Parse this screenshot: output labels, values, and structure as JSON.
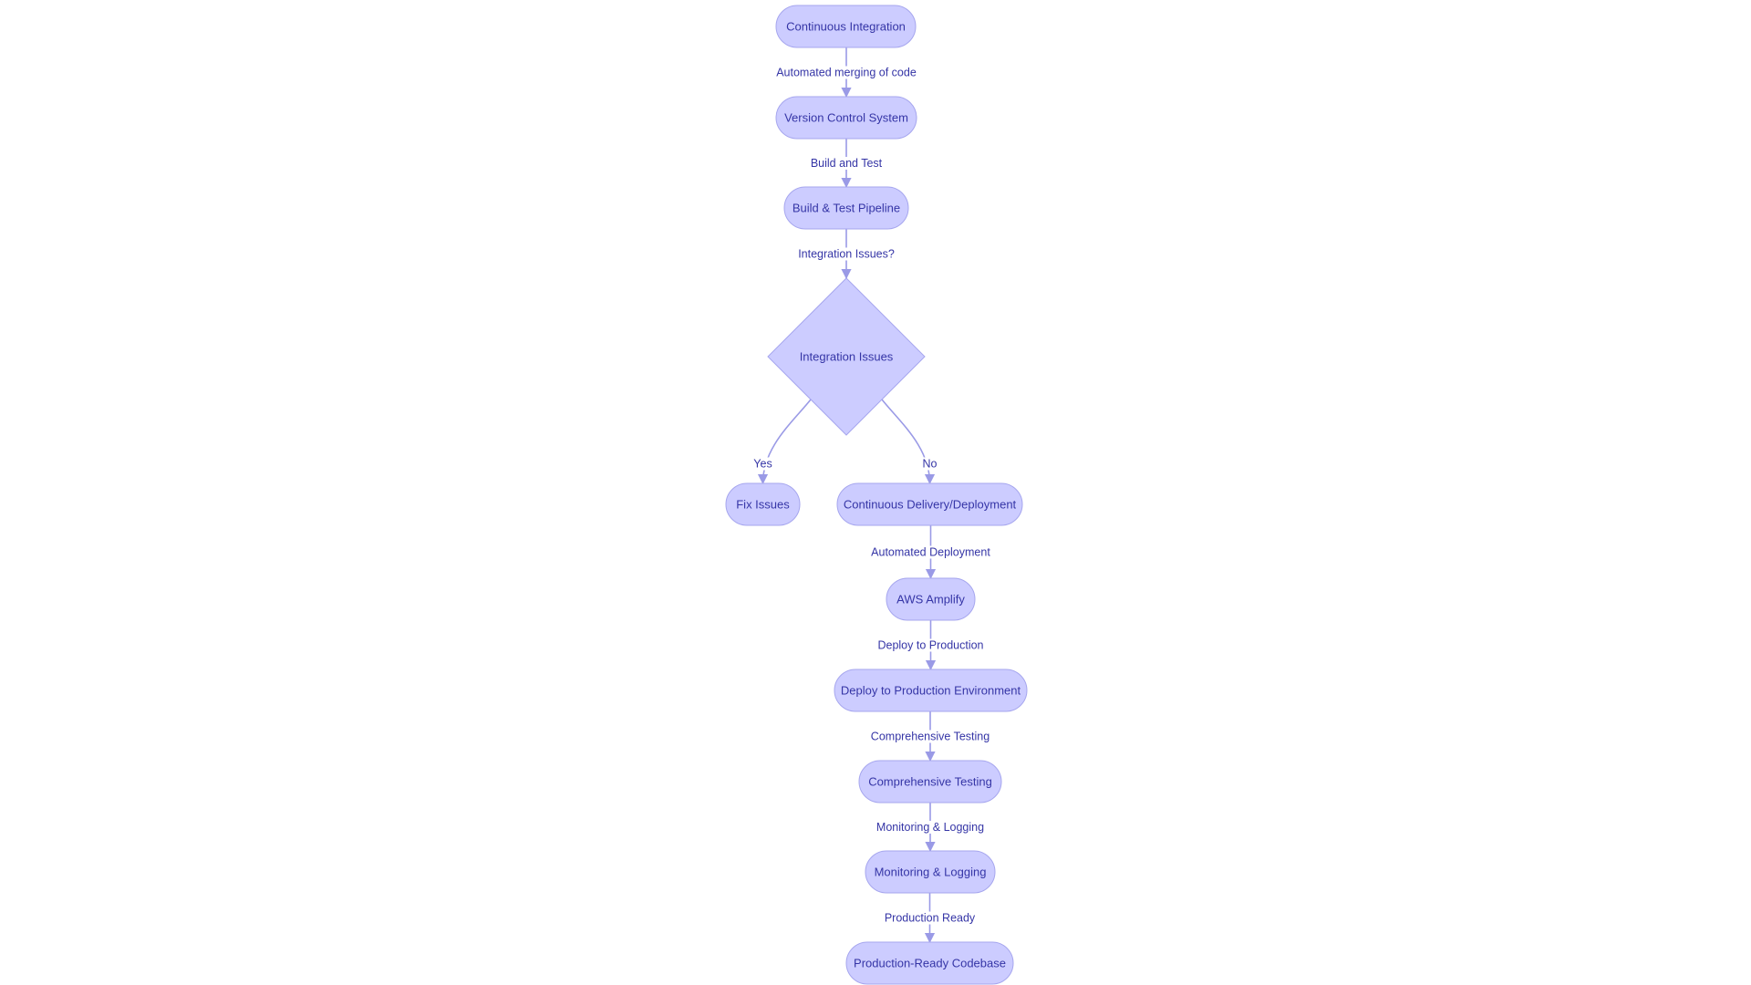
{
  "colors": {
    "node_fill": "#ccccff",
    "node_stroke": "#a6a6ee",
    "edge": "#9a9ae6",
    "text": "#3535a6",
    "background": "#ffffff"
  },
  "nodes": [
    {
      "id": "ci",
      "label": "Continuous Integration",
      "shape": "rounded"
    },
    {
      "id": "vcs",
      "label": "Version Control System",
      "shape": "rounded"
    },
    {
      "id": "build",
      "label": "Build & Test Pipeline",
      "shape": "rounded"
    },
    {
      "id": "issues",
      "label": "Integration Issues",
      "shape": "diamond"
    },
    {
      "id": "fix",
      "label": "Fix Issues",
      "shape": "rounded"
    },
    {
      "id": "cd",
      "label": "Continuous Delivery/Deployment",
      "shape": "rounded"
    },
    {
      "id": "amplify",
      "label": "AWS Amplify",
      "shape": "rounded"
    },
    {
      "id": "deploy",
      "label": "Deploy to Production Environment",
      "shape": "rounded"
    },
    {
      "id": "testing",
      "label": "Comprehensive Testing",
      "shape": "rounded"
    },
    {
      "id": "monitor",
      "label": "Monitoring & Logging",
      "shape": "rounded"
    },
    {
      "id": "ready",
      "label": "Production-Ready Codebase",
      "shape": "rounded"
    }
  ],
  "edges": [
    {
      "from": "ci",
      "to": "vcs",
      "label": "Automated merging of code"
    },
    {
      "from": "vcs",
      "to": "build",
      "label": "Build and Test"
    },
    {
      "from": "build",
      "to": "issues",
      "label": "Integration Issues?"
    },
    {
      "from": "issues",
      "to": "fix",
      "label": "Yes"
    },
    {
      "from": "issues",
      "to": "cd",
      "label": "No"
    },
    {
      "from": "cd",
      "to": "amplify",
      "label": "Automated Deployment"
    },
    {
      "from": "amplify",
      "to": "deploy",
      "label": "Deploy to Production"
    },
    {
      "from": "deploy",
      "to": "testing",
      "label": "Comprehensive Testing"
    },
    {
      "from": "testing",
      "to": "monitor",
      "label": "Monitoring & Logging"
    },
    {
      "from": "monitor",
      "to": "ready",
      "label": "Production Ready"
    }
  ]
}
